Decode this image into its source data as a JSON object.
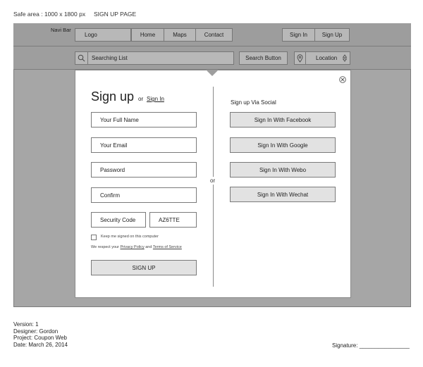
{
  "header": {
    "safe_area": "Safe area : 1000 x 1800 px",
    "page_name": "SIGN UP PAGE"
  },
  "navbar": {
    "label": "Navi Bar",
    "logo": "Logo",
    "links": [
      "Home",
      "Maps",
      "Contact"
    ],
    "sign_in": "Sign In",
    "sign_up": "Sign Up"
  },
  "search": {
    "placeholder": "Searching List",
    "button": "Search Button",
    "location": "Location"
  },
  "modal": {
    "title": "Sign up",
    "or_text": "or",
    "sign_in_link": "Sign In",
    "fields": {
      "full_name": "Your Full Name",
      "email": "Your Email",
      "password": "Password",
      "confirm": "Confirm",
      "security_code": "Security Code",
      "captcha": "AZ6TTE"
    },
    "keep_signed": "Keep me signed on this computer",
    "respect_prefix": "We respect your",
    "privacy_policy": "Privacy Policy",
    "and": "and",
    "terms": "Terms of Service",
    "signup_button": "SIGN UP",
    "divider_or": "or",
    "social_heading": "Sign up Via Social",
    "social": [
      "Sign In With Facebook",
      "Sign In With Google",
      "Sign In With Webo",
      "Sign In With Wechat"
    ]
  },
  "footer": {
    "version": "Version: 1",
    "designer": "Designer: Gordon",
    "project": "Project: Coupon Web",
    "date": "Date: March 26, 2014",
    "signature": "Signature: ________________"
  }
}
